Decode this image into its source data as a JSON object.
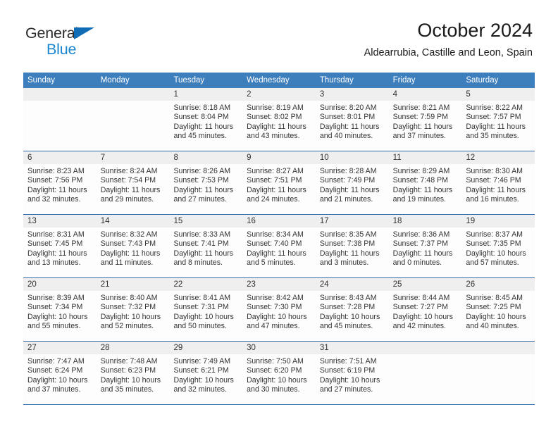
{
  "brand": {
    "line1": "General",
    "line2": "Blue",
    "triangle_color": "#0f6cb5",
    "line2_color": "#1a86d0"
  },
  "header": {
    "title": "October 2024",
    "subtitle": "Aldearrubia, Castille and Leon, Spain"
  },
  "theme": {
    "header_bg": "#3d7ebc",
    "row_divider": "#2f6ba8",
    "daynum_band": "#efefef",
    "cell_bg": "#fdfdfd",
    "text": "#333333"
  },
  "weekdays": [
    "Sunday",
    "Monday",
    "Tuesday",
    "Wednesday",
    "Thursday",
    "Friday",
    "Saturday"
  ],
  "weeks": [
    [
      {
        "day": "",
        "sunrise": "",
        "sunset": "",
        "daylight1": "",
        "daylight2": "",
        "empty": true
      },
      {
        "day": "",
        "sunrise": "",
        "sunset": "",
        "daylight1": "",
        "daylight2": "",
        "empty": true
      },
      {
        "day": "1",
        "sunrise": "Sunrise: 8:18 AM",
        "sunset": "Sunset: 8:04 PM",
        "daylight1": "Daylight: 11 hours",
        "daylight2": "and 45 minutes."
      },
      {
        "day": "2",
        "sunrise": "Sunrise: 8:19 AM",
        "sunset": "Sunset: 8:02 PM",
        "daylight1": "Daylight: 11 hours",
        "daylight2": "and 43 minutes."
      },
      {
        "day": "3",
        "sunrise": "Sunrise: 8:20 AM",
        "sunset": "Sunset: 8:01 PM",
        "daylight1": "Daylight: 11 hours",
        "daylight2": "and 40 minutes."
      },
      {
        "day": "4",
        "sunrise": "Sunrise: 8:21 AM",
        "sunset": "Sunset: 7:59 PM",
        "daylight1": "Daylight: 11 hours",
        "daylight2": "and 37 minutes."
      },
      {
        "day": "5",
        "sunrise": "Sunrise: 8:22 AM",
        "sunset": "Sunset: 7:57 PM",
        "daylight1": "Daylight: 11 hours",
        "daylight2": "and 35 minutes."
      }
    ],
    [
      {
        "day": "6",
        "sunrise": "Sunrise: 8:23 AM",
        "sunset": "Sunset: 7:56 PM",
        "daylight1": "Daylight: 11 hours",
        "daylight2": "and 32 minutes."
      },
      {
        "day": "7",
        "sunrise": "Sunrise: 8:24 AM",
        "sunset": "Sunset: 7:54 PM",
        "daylight1": "Daylight: 11 hours",
        "daylight2": "and 29 minutes."
      },
      {
        "day": "8",
        "sunrise": "Sunrise: 8:26 AM",
        "sunset": "Sunset: 7:53 PM",
        "daylight1": "Daylight: 11 hours",
        "daylight2": "and 27 minutes."
      },
      {
        "day": "9",
        "sunrise": "Sunrise: 8:27 AM",
        "sunset": "Sunset: 7:51 PM",
        "daylight1": "Daylight: 11 hours",
        "daylight2": "and 24 minutes."
      },
      {
        "day": "10",
        "sunrise": "Sunrise: 8:28 AM",
        "sunset": "Sunset: 7:49 PM",
        "daylight1": "Daylight: 11 hours",
        "daylight2": "and 21 minutes."
      },
      {
        "day": "11",
        "sunrise": "Sunrise: 8:29 AM",
        "sunset": "Sunset: 7:48 PM",
        "daylight1": "Daylight: 11 hours",
        "daylight2": "and 19 minutes."
      },
      {
        "day": "12",
        "sunrise": "Sunrise: 8:30 AM",
        "sunset": "Sunset: 7:46 PM",
        "daylight1": "Daylight: 11 hours",
        "daylight2": "and 16 minutes."
      }
    ],
    [
      {
        "day": "13",
        "sunrise": "Sunrise: 8:31 AM",
        "sunset": "Sunset: 7:45 PM",
        "daylight1": "Daylight: 11 hours",
        "daylight2": "and 13 minutes."
      },
      {
        "day": "14",
        "sunrise": "Sunrise: 8:32 AM",
        "sunset": "Sunset: 7:43 PM",
        "daylight1": "Daylight: 11 hours",
        "daylight2": "and 11 minutes."
      },
      {
        "day": "15",
        "sunrise": "Sunrise: 8:33 AM",
        "sunset": "Sunset: 7:41 PM",
        "daylight1": "Daylight: 11 hours",
        "daylight2": "and 8 minutes."
      },
      {
        "day": "16",
        "sunrise": "Sunrise: 8:34 AM",
        "sunset": "Sunset: 7:40 PM",
        "daylight1": "Daylight: 11 hours",
        "daylight2": "and 5 minutes."
      },
      {
        "day": "17",
        "sunrise": "Sunrise: 8:35 AM",
        "sunset": "Sunset: 7:38 PM",
        "daylight1": "Daylight: 11 hours",
        "daylight2": "and 3 minutes."
      },
      {
        "day": "18",
        "sunrise": "Sunrise: 8:36 AM",
        "sunset": "Sunset: 7:37 PM",
        "daylight1": "Daylight: 11 hours",
        "daylight2": "and 0 minutes."
      },
      {
        "day": "19",
        "sunrise": "Sunrise: 8:37 AM",
        "sunset": "Sunset: 7:35 PM",
        "daylight1": "Daylight: 10 hours",
        "daylight2": "and 57 minutes."
      }
    ],
    [
      {
        "day": "20",
        "sunrise": "Sunrise: 8:39 AM",
        "sunset": "Sunset: 7:34 PM",
        "daylight1": "Daylight: 10 hours",
        "daylight2": "and 55 minutes."
      },
      {
        "day": "21",
        "sunrise": "Sunrise: 8:40 AM",
        "sunset": "Sunset: 7:32 PM",
        "daylight1": "Daylight: 10 hours",
        "daylight2": "and 52 minutes."
      },
      {
        "day": "22",
        "sunrise": "Sunrise: 8:41 AM",
        "sunset": "Sunset: 7:31 PM",
        "daylight1": "Daylight: 10 hours",
        "daylight2": "and 50 minutes."
      },
      {
        "day": "23",
        "sunrise": "Sunrise: 8:42 AM",
        "sunset": "Sunset: 7:30 PM",
        "daylight1": "Daylight: 10 hours",
        "daylight2": "and 47 minutes."
      },
      {
        "day": "24",
        "sunrise": "Sunrise: 8:43 AM",
        "sunset": "Sunset: 7:28 PM",
        "daylight1": "Daylight: 10 hours",
        "daylight2": "and 45 minutes."
      },
      {
        "day": "25",
        "sunrise": "Sunrise: 8:44 AM",
        "sunset": "Sunset: 7:27 PM",
        "daylight1": "Daylight: 10 hours",
        "daylight2": "and 42 minutes."
      },
      {
        "day": "26",
        "sunrise": "Sunrise: 8:45 AM",
        "sunset": "Sunset: 7:25 PM",
        "daylight1": "Daylight: 10 hours",
        "daylight2": "and 40 minutes."
      }
    ],
    [
      {
        "day": "27",
        "sunrise": "Sunrise: 7:47 AM",
        "sunset": "Sunset: 6:24 PM",
        "daylight1": "Daylight: 10 hours",
        "daylight2": "and 37 minutes."
      },
      {
        "day": "28",
        "sunrise": "Sunrise: 7:48 AM",
        "sunset": "Sunset: 6:23 PM",
        "daylight1": "Daylight: 10 hours",
        "daylight2": "and 35 minutes."
      },
      {
        "day": "29",
        "sunrise": "Sunrise: 7:49 AM",
        "sunset": "Sunset: 6:21 PM",
        "daylight1": "Daylight: 10 hours",
        "daylight2": "and 32 minutes."
      },
      {
        "day": "30",
        "sunrise": "Sunrise: 7:50 AM",
        "sunset": "Sunset: 6:20 PM",
        "daylight1": "Daylight: 10 hours",
        "daylight2": "and 30 minutes."
      },
      {
        "day": "31",
        "sunrise": "Sunrise: 7:51 AM",
        "sunset": "Sunset: 6:19 PM",
        "daylight1": "Daylight: 10 hours",
        "daylight2": "and 27 minutes."
      },
      {
        "day": "",
        "sunrise": "",
        "sunset": "",
        "daylight1": "",
        "daylight2": "",
        "empty": true
      },
      {
        "day": "",
        "sunrise": "",
        "sunset": "",
        "daylight1": "",
        "daylight2": "",
        "empty": true
      }
    ]
  ]
}
